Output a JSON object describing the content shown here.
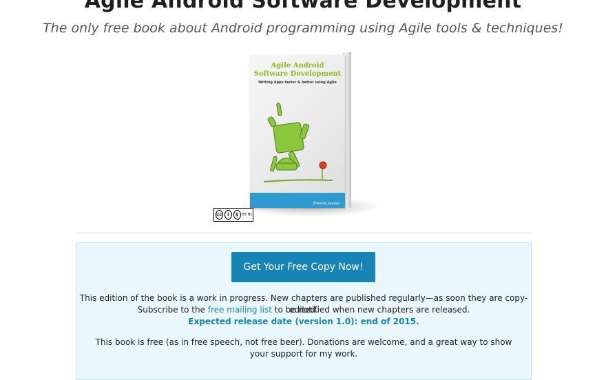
{
  "header": {
    "title": "Agile Android Software Development",
    "subtitle": "The only free book about Android programming using Agile tools & techniques!"
  },
  "book": {
    "cover_title_line1": "Agile Android",
    "cover_title_line2": "Software Development",
    "cover_subtitle": "Writing Apps faster & better using Agile",
    "author": "Étienne Savard"
  },
  "license": {
    "cc_symbol": "cc",
    "by_symbol": "i",
    "nc_symbol": "$",
    "by_label": "BY",
    "nc_label": "NC"
  },
  "cta": {
    "label": "Get Your Free Copy Now!"
  },
  "info": {
    "line1": "This edition of the book is a work in progress. New chapters are published regularly—as soon they are copy-edited.",
    "line2_before": "Subscribe to the ",
    "line2_link": "free mailing list",
    "line2_after": " to be notified when new chapters are released.",
    "release": "Expected release date (version 1.0): end of 2015.",
    "donation": "This book is free (as in free speech, not free beer). Donations are welcome, and a great way to show your support for my work."
  },
  "colors": {
    "accent": "#1685b5",
    "panel_bg": "#eaf7fc",
    "cover_green": "#8dba1e"
  }
}
